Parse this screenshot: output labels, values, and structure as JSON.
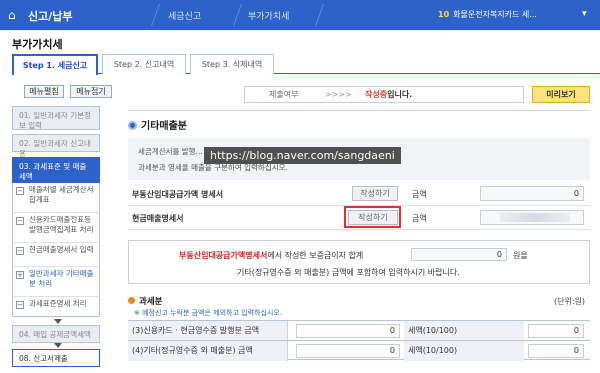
{
  "topbar": {
    "menu_label": "신고/납부",
    "crumbs": [
      "세금신고",
      "부가가치세"
    ],
    "notice_num": "10",
    "notice_text": "화물운전자복지카드 세...",
    "chevron": "▾"
  },
  "page_title": "부가가치세",
  "tabs": [
    "Step 1. 세금신고",
    "Step 2. 신고내역",
    "Step 3. 삭제내역"
  ],
  "sidebar": {
    "expand_label": "메뉴펼침",
    "collapse_label": "메뉴접기",
    "items": [
      {
        "label": "01. 일반과세자 기본정보 입력"
      },
      {
        "label": "02. 일반과세자 신고내용"
      },
      {
        "label": "03. 과세표준 및 매출세액"
      },
      {
        "label": "04. 매입 공제금액세액"
      },
      {
        "label": "08. 신고서제출"
      }
    ],
    "sub_items": [
      {
        "label": "매출처별 세금계산서 합계표",
        "mark": "−"
      },
      {
        "label": "신용카드매출전표등 발행금액집계표 처리",
        "mark": "−"
      },
      {
        "label": "현금매출명세서 입력",
        "mark": "−"
      },
      {
        "label": "일반과세자 기타매출분 처리",
        "mark": "+"
      },
      {
        "label": "과세표준명세 처리",
        "mark": "−"
      }
    ]
  },
  "status": {
    "label": "제출여부",
    "arrows": ">>>>",
    "value_red": "작성중",
    "value_suffix": "입니다.",
    "preview_label": "미리보기"
  },
  "section": {
    "title": "기타매출분",
    "info_lines": [
      "세금계산서를 발행...",
      "과세분과 영세율 매출을 구분하여 입력하십시오."
    ],
    "watermark": "https://blog.naver.com/sangdaeni"
  },
  "rows": [
    {
      "label": "부동산임대공급가액 명세서",
      "button": "작성하기",
      "amount_label": "금액",
      "amount": "0"
    },
    {
      "label": "현금매출명세서",
      "button": "작성하기",
      "amount_label": "금액",
      "amount": ""
    }
  ],
  "note": {
    "red_part": "부동산임대공급가액명세서",
    "line1_rest": "에서 작성한 보증금이자 합계",
    "value": "0",
    "unit": "원을",
    "line2": "기타(정규영수증 외 매출분) 금액에 포함하여 입력하시기 바랍니다."
  },
  "tax": {
    "title": "과세분",
    "unit_label": "(단위:원)",
    "hint": "※ 예정신고 누락분 금액은 제외하고 입력하십시오.",
    "rows": [
      {
        "label": "(3)신용카드 · 현금영수증 발행분 금액",
        "value": "0",
        "tax_label": "세액(10/100)",
        "tax_value": "0"
      },
      {
        "label": "(4)기타(정규영수증 외 매출분) 금액",
        "value": "0",
        "tax_label": "세액(10/100)",
        "tax_value": "0"
      }
    ]
  }
}
